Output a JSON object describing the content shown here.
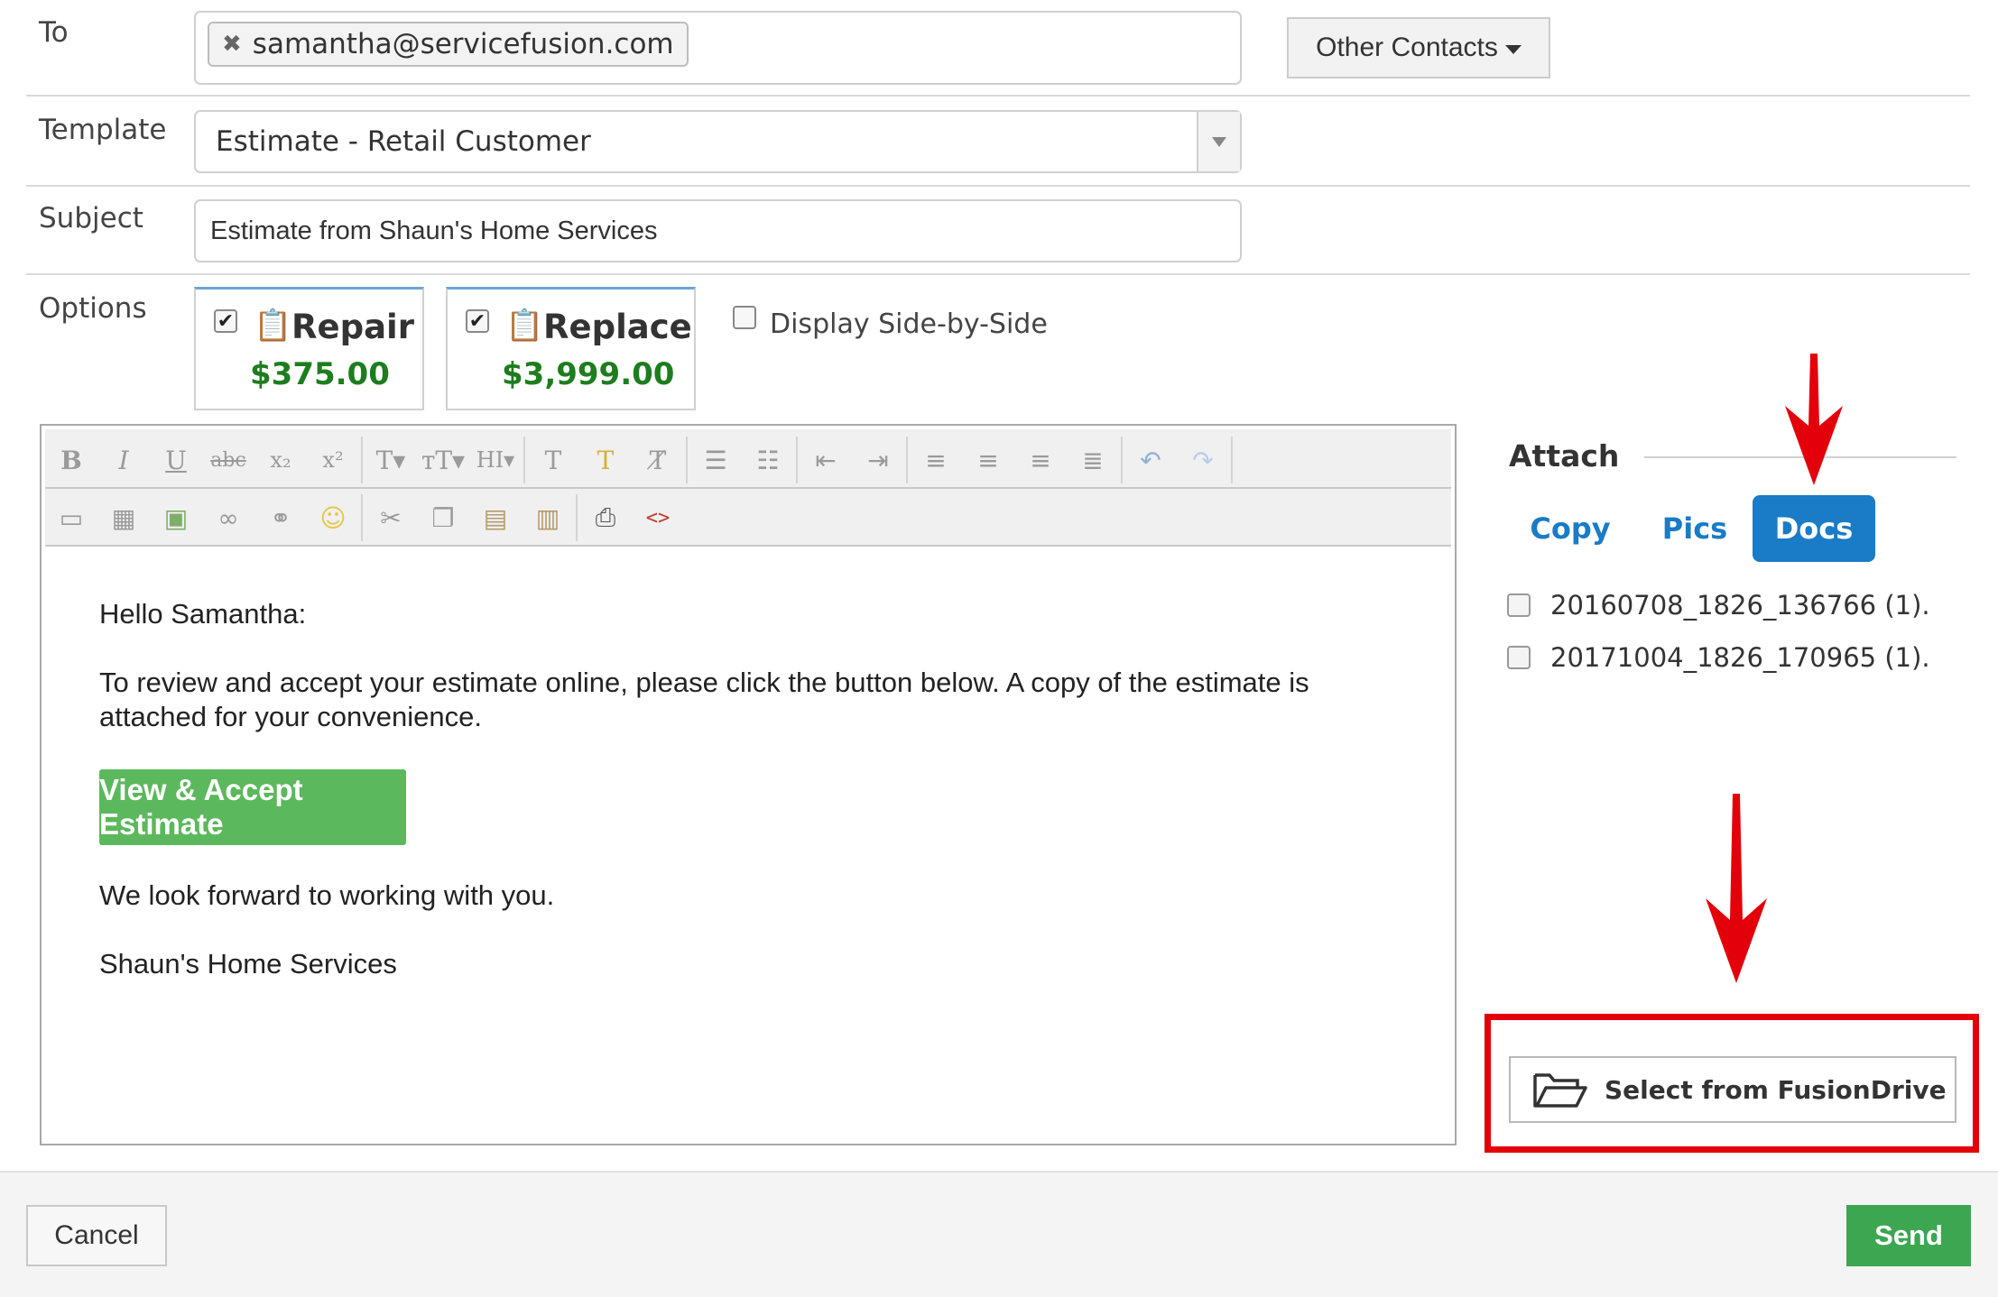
{
  "to": {
    "label": "To",
    "recipients": [
      {
        "remove_icon": "✖",
        "email": "samantha@servicefusion.com"
      }
    ],
    "other_contacts_label": "Other Contacts"
  },
  "template": {
    "label": "Template",
    "selected": "Estimate - Retail Customer"
  },
  "subject": {
    "label": "Subject",
    "value": "Estimate from Shaun's Home Services"
  },
  "options": {
    "label": "Options",
    "items": [
      {
        "name": "Repair",
        "price": "$375.00",
        "checked": true
      },
      {
        "name": "Replace",
        "price": "$3,999.00",
        "checked": true
      }
    ],
    "side_by_side_label": "Display Side-by-Side"
  },
  "editor": {
    "toolbar_row1": [
      "bold-icon",
      "italic-icon",
      "underline-icon",
      "strikethrough-icon",
      "subscript-icon",
      "superscript-icon",
      "font-icon",
      "font-size-icon",
      "heading-icon",
      "text-color-icon",
      "highlight-icon",
      "clear-format-icon",
      "bullet-list-icon",
      "numbered-list-icon",
      "outdent-icon",
      "indent-icon",
      "align-left-icon",
      "align-center-icon",
      "align-right-icon",
      "justify-icon",
      "undo-icon",
      "redo-icon"
    ],
    "toolbar_row2": [
      "horizontal-rule-icon",
      "table-icon",
      "image-icon",
      "link-icon",
      "unlink-icon",
      "emoji-icon",
      "cut-icon",
      "copy-icon",
      "paste-icon",
      "paste-text-icon",
      "print-icon",
      "source-code-icon"
    ],
    "greeting": "Hello Samantha:",
    "paragraph": "To review and accept your estimate online, please click the button below. A copy of the estimate is",
    "paragraph_cont": "attached for your convenience.",
    "cta_label": "View & Accept Estimate",
    "closing": "We look forward to working with you.",
    "signature": "Shaun's Home Services"
  },
  "attach": {
    "title": "Attach",
    "tabs": [
      {
        "label": "Copy",
        "active": false
      },
      {
        "label": "Pics",
        "active": false
      },
      {
        "label": "Docs",
        "active": true
      }
    ],
    "files": [
      "20160708_1826_136766 (1).",
      "20171004_1826_170965 (1)."
    ],
    "fusiondrive_label": "Select from FusionDrive"
  },
  "footer": {
    "cancel_label": "Cancel",
    "send_label": "Send"
  },
  "colors": {
    "accent": "#1a7bc6",
    "price": "#1e7d1e",
    "cta": "#5cb85c",
    "send": "#3ca651",
    "highlight": "#e3000b"
  }
}
